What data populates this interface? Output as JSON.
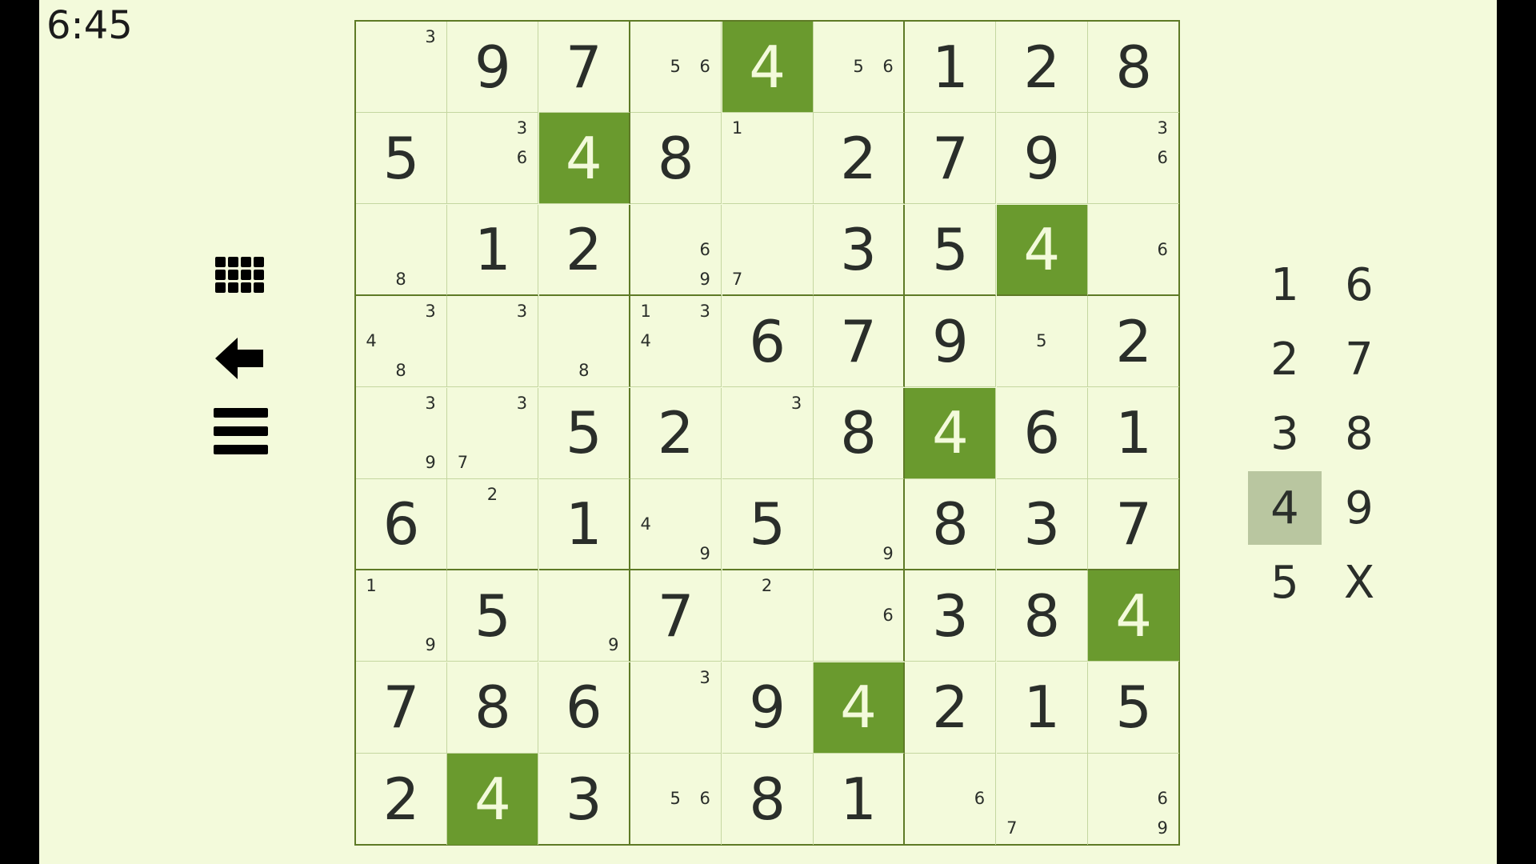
{
  "timer": "6:45",
  "grid": {
    "cells": [
      [
        {
          "n": [
            "3"
          ]
        },
        {
          "v": "9"
        },
        {
          "v": "7"
        },
        {
          "n": [
            "5",
            "6"
          ]
        },
        {
          "v": "4",
          "hl": true
        },
        {
          "n": [
            "5",
            "6"
          ]
        },
        {
          "v": "1"
        },
        {
          "v": "2"
        },
        {
          "v": "8"
        }
      ],
      [
        {
          "v": "5"
        },
        {
          "n": [
            "3",
            "6"
          ]
        },
        {
          "v": "4",
          "hl": true
        },
        {
          "v": "8"
        },
        {
          "n": [
            "1"
          ]
        },
        {
          "v": "2"
        },
        {
          "v": "7"
        },
        {
          "v": "9"
        },
        {
          "n": [
            "3",
            "6"
          ]
        }
      ],
      [
        {
          "n": [
            "8"
          ]
        },
        {
          "v": "1"
        },
        {
          "v": "2"
        },
        {
          "n": [
            "6",
            "9"
          ]
        },
        {
          "n": [
            "7"
          ]
        },
        {
          "v": "3"
        },
        {
          "v": "5"
        },
        {
          "v": "4",
          "hl": true
        },
        {
          "n": [
            "6"
          ]
        }
      ],
      [
        {
          "n": [
            "3",
            "4",
            "8"
          ]
        },
        {
          "n": [
            "3"
          ]
        },
        {
          "n": [
            "8"
          ]
        },
        {
          "n": [
            "1",
            "3",
            "4"
          ]
        },
        {
          "v": "6"
        },
        {
          "v": "7"
        },
        {
          "v": "9"
        },
        {
          "n": [
            "5"
          ]
        },
        {
          "v": "2"
        }
      ],
      [
        {
          "n": [
            "3",
            "9"
          ]
        },
        {
          "n": [
            "3",
            "7"
          ]
        },
        {
          "v": "5"
        },
        {
          "v": "2"
        },
        {
          "n": [
            "3"
          ]
        },
        {
          "v": "8"
        },
        {
          "v": "4",
          "hl": true
        },
        {
          "v": "6"
        },
        {
          "v": "1"
        }
      ],
      [
        {
          "v": "6"
        },
        {
          "n": [
            "2"
          ]
        },
        {
          "v": "1"
        },
        {
          "n": [
            "4",
            "9"
          ]
        },
        {
          "v": "5"
        },
        {
          "n": [
            "9"
          ]
        },
        {
          "v": "8"
        },
        {
          "v": "3"
        },
        {
          "v": "7"
        }
      ],
      [
        {
          "n": [
            "1",
            "9"
          ]
        },
        {
          "v": "5"
        },
        {
          "n": [
            "9"
          ]
        },
        {
          "v": "7"
        },
        {
          "n": [
            "2"
          ]
        },
        {
          "n": [
            "6"
          ]
        },
        {
          "v": "3"
        },
        {
          "v": "8"
        },
        {
          "v": "4",
          "hl": true
        }
      ],
      [
        {
          "v": "7"
        },
        {
          "v": "8"
        },
        {
          "v": "6"
        },
        {
          "n": [
            "3"
          ]
        },
        {
          "v": "9"
        },
        {
          "v": "4",
          "hl": true
        },
        {
          "v": "2"
        },
        {
          "v": "1"
        },
        {
          "v": "5"
        }
      ],
      [
        {
          "v": "2"
        },
        {
          "v": "4",
          "hl": true
        },
        {
          "v": "3"
        },
        {
          "n": [
            "5",
            "6"
          ]
        },
        {
          "v": "8"
        },
        {
          "v": "1"
        },
        {
          "n": [
            "6"
          ]
        },
        {
          "n": [
            "7"
          ]
        },
        {
          "n": [
            "6",
            "9"
          ]
        }
      ]
    ]
  },
  "tools": [
    {
      "name": "pencil-grid-icon"
    },
    {
      "name": "undo-arrow-icon"
    },
    {
      "name": "menu-icon"
    }
  ],
  "keypad": {
    "keys": [
      "1",
      "2",
      "3",
      "4",
      "5",
      "6",
      "7",
      "8",
      "9",
      "X"
    ],
    "selected": "4"
  },
  "colors": {
    "highlight": "#6a9a2e",
    "background": "#f3fadb",
    "selected_key": "#b9c6a0"
  }
}
